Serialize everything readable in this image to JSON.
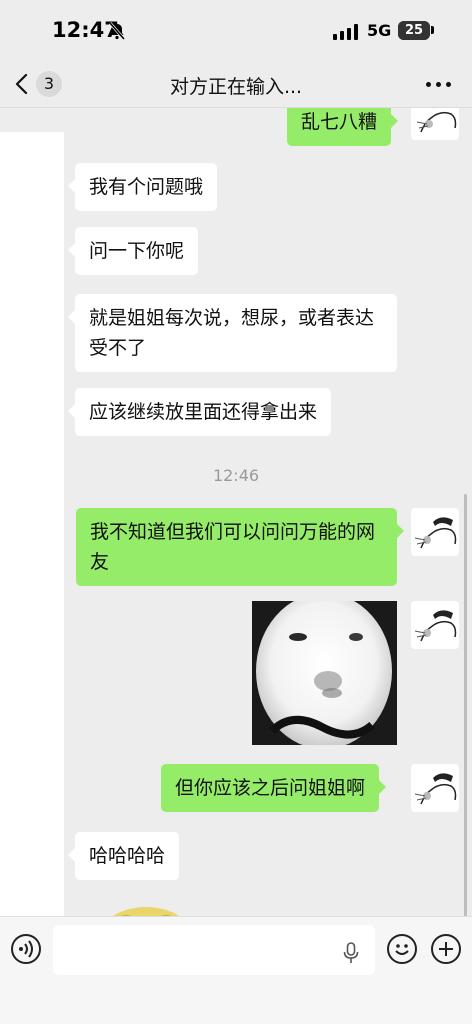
{
  "status_bar": {
    "time": "12:47",
    "network": "5G",
    "battery": "25",
    "icons": [
      "bell-muted-icon",
      "signal-icon",
      "battery-icon"
    ]
  },
  "nav": {
    "back_count": "3",
    "title": "对方正在输入...",
    "icons": [
      "chevron-left-icon",
      "more-icon"
    ]
  },
  "messages": [
    {
      "side": "out",
      "text": "乱七八糟"
    },
    {
      "side": "in",
      "text": "我有个问题哦"
    },
    {
      "side": "in",
      "text": "问一下你呢"
    },
    {
      "side": "in",
      "text": "就是姐姐每次说，想尿，或者表达受不了"
    },
    {
      "side": "in",
      "text": "应该继续放里面还得拿出来"
    },
    {
      "type": "time",
      "text": "12:46"
    },
    {
      "side": "out",
      "text": "我不知道但我们可以问问万能的网友"
    },
    {
      "side": "out",
      "type": "sticker",
      "icon": "meme-face-sticker"
    },
    {
      "side": "out",
      "text": "但你应该之后问姐姐啊"
    },
    {
      "side": "in",
      "text": "哈哈哈哈"
    },
    {
      "side": "in",
      "type": "sticker",
      "icon": "yellow-sticker-partial"
    }
  ],
  "input_bar": {
    "placeholder": "",
    "icons": [
      "voice-icon",
      "mic-icon",
      "emoji-icon",
      "plus-icon"
    ]
  },
  "colors": {
    "background": "#ededed",
    "outgoing_bubble": "#95ec69",
    "incoming_bubble": "#ffffff",
    "timestamp": "#9a9a9a"
  }
}
